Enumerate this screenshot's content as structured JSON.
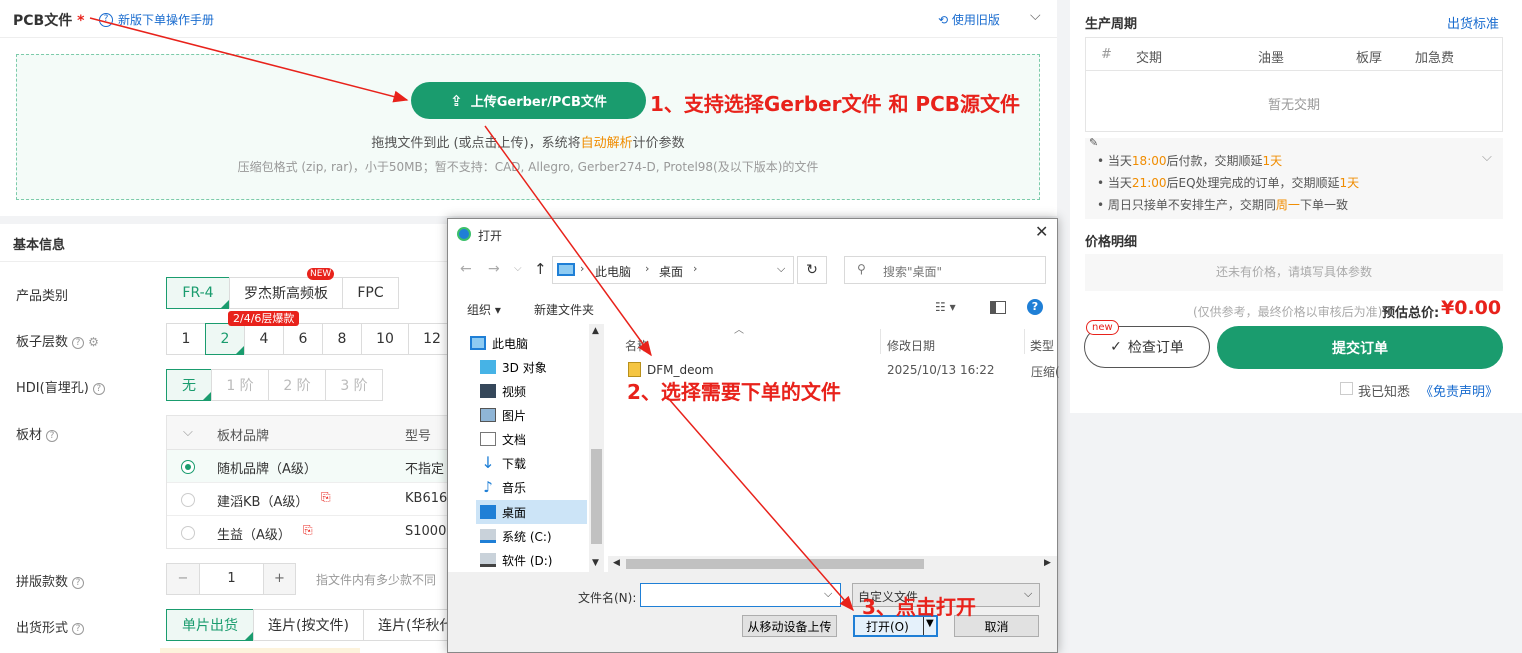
{
  "pcb": {
    "title": "PCB文件",
    "required": "*",
    "manual": "新版下单操作手册",
    "old": "使用旧版",
    "upload": "上传Gerber/PCB文件",
    "hint_pre": "拖拽文件到此 (或点击上传)，系统将",
    "hint_hl": "自动解析",
    "hint_post": "计价参数",
    "formats": "压缩包格式 (zip, rar)，小于50MB；暂不支持：CAD, Allegro, Gerber274-D, Protel98(及以下版本)的文件"
  },
  "basic": {
    "title": "基本信息",
    "product": {
      "label": "产品类别",
      "options": [
        "FR-4",
        "罗杰斯高频板",
        "FPC"
      ],
      "new_badge": "NEW"
    },
    "layers": {
      "label": "板子层数",
      "options": [
        "1",
        "2",
        "4",
        "6",
        "8",
        "10",
        "12"
      ],
      "tip": "2/4/6层爆款"
    },
    "hdi": {
      "label": "HDI(盲埋孔)",
      "options": [
        "无",
        "1 阶",
        "2 阶",
        "3 阶"
      ]
    },
    "material": {
      "label": "板材",
      "col_brand": "板材品牌",
      "col_model": "型号",
      "rows": [
        {
          "brand": "随机品牌（A级）",
          "model": "不指定"
        },
        {
          "brand": "建滔KB（A级）",
          "model": "KB616"
        },
        {
          "brand": "生益（A级）",
          "model": "S1000"
        }
      ]
    },
    "panel": {
      "label": "拼版款数",
      "value": "1",
      "minus": "−",
      "plus": "+",
      "hint": "指文件内有多少款不同"
    },
    "ship": {
      "label": "出货形式",
      "options": [
        "单片出货",
        "连片(按文件)",
        "连片(华秋代"
      ]
    }
  },
  "right": {
    "cycle_title": "生产周期",
    "ship_std": "出货标准",
    "cols": [
      "#",
      "交期",
      "油墨",
      "板厚",
      "加急费"
    ],
    "empty": "暂无交期",
    "notes": [
      {
        "a": "当天",
        "b": "18:00",
        "c": "后付款，交期顺延",
        "d": "1天"
      },
      {
        "a": "当天",
        "b": "21:00",
        "c": "后EQ处理完成的订单，交期顺延",
        "d": "1天"
      },
      {
        "a": "周日只接单不安排生产，交期同",
        "b": "周一",
        "c": "下单一致",
        "d": ""
      }
    ],
    "price_title": "价格明细",
    "price_empty": "还未有价格，请填写具体参数",
    "ref": "(仅供参考，最终价格以审核后为准)",
    "total_label": "预估总价:",
    "total": "¥0.00",
    "check": "检查订单",
    "new": "new",
    "submit": "提交订单",
    "agree": "我已知悉",
    "disclaimer": "《免责声明》"
  },
  "dialog": {
    "title": "打开",
    "path": [
      "此电脑",
      "桌面"
    ],
    "search": "搜索\"桌面\"",
    "organize": "组织",
    "newfolder": "新建文件夹",
    "tree": [
      "此电脑",
      "3D 对象",
      "视频",
      "图片",
      "文档",
      "下载",
      "音乐",
      "桌面",
      "系统 (C:)",
      "软件 (D:)"
    ],
    "cols": [
      "名称",
      "修改日期",
      "类型"
    ],
    "file": {
      "name": "DFM_deom",
      "date": "2025/10/13 16:22",
      "type": "压缩("
    },
    "filename_label": "文件名(N):",
    "filetype": "自定义文件",
    "mobile": "从移动设备上传",
    "open": "打开(O)",
    "cancel": "取消"
  },
  "annotations": {
    "a1": "1、支持选择Gerber文件 和 PCB源文件",
    "a2": "2、选择需要下单的文件",
    "a3": "3、点击打开"
  },
  "colors": {
    "accent": "#1a9c6e",
    "annotation": "#e8221b",
    "price": "#e8221b",
    "highlight": "#f08c00"
  }
}
